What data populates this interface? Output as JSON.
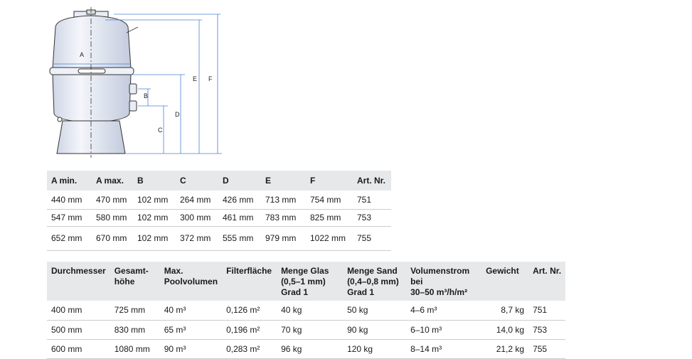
{
  "diagram": {
    "labels": {
      "a": "A",
      "b": "B",
      "c": "C",
      "d": "D",
      "e": "E",
      "f": "F"
    }
  },
  "table_dimensions": {
    "headers": [
      "A min.",
      "A max.",
      "B",
      "C",
      "D",
      "E",
      "F",
      "Art. Nr."
    ],
    "rows": [
      [
        "440 mm",
        "470 mm",
        "102 mm",
        "264 mm",
        "426 mm",
        "713 mm",
        "754 mm",
        "751"
      ],
      [
        "547 mm",
        "580 mm",
        "102 mm",
        "300 mm",
        "461 mm",
        "783 mm",
        "825 mm",
        "753"
      ],
      [
        "652 mm",
        "670 mm",
        "102 mm",
        "372 mm",
        "555 mm",
        "979 mm",
        "1022 mm",
        "755"
      ]
    ]
  },
  "table_specs": {
    "headers": [
      "Durchmesser",
      "Gesamt-\nhöhe",
      "Max.\nPoolvolumen",
      "Filterfläche",
      "Menge Glas\n(0,5–1 mm)\nGrad 1",
      "Menge Sand\n(0,4–0,8 mm)\nGrad 1",
      "Volumenstrom bei\n30–50 m³/h/m²",
      "Gewicht",
      "Art. Nr."
    ],
    "rows": [
      [
        "400 mm",
        "725 mm",
        "40 m³",
        "0,126 m²",
        "40 kg",
        "50 kg",
        "4–6 m³",
        "8,7 kg",
        "751"
      ],
      [
        "500 mm",
        "830 mm",
        "65 m³",
        "0,196 m²",
        "70 kg",
        "90 kg",
        "6–10 m³",
        "14,0 kg",
        "753"
      ],
      [
        "600 mm",
        "1080 mm",
        "90 m³",
        "0,283 m²",
        "96 kg",
        "120 kg",
        "8–14 m³",
        "21,2 kg",
        "755"
      ]
    ]
  }
}
